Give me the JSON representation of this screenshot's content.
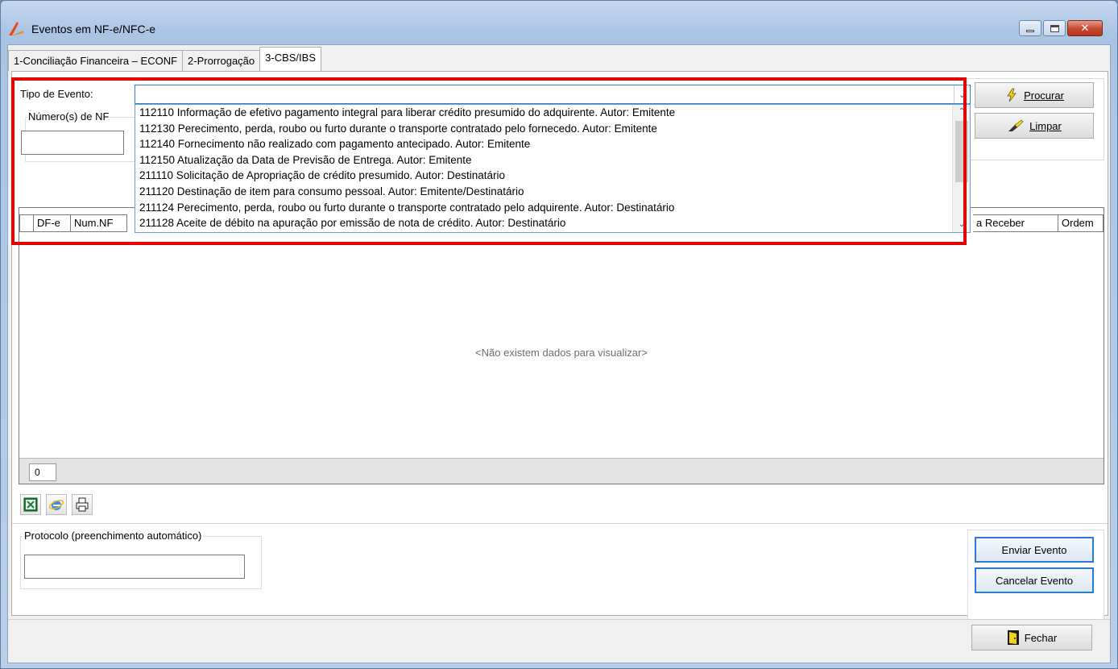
{
  "window": {
    "title": "Eventos em NF-e/NFC-e"
  },
  "tabs": [
    {
      "label": "1-Conciliação Financeira – ECONF"
    },
    {
      "label": "2-Prorrogação"
    },
    {
      "label": "3-CBS/IBS"
    }
  ],
  "filter": {
    "tipo_evento_label": "Tipo de Evento:",
    "numeros_label": "Número(s) de NF",
    "tipo_evento_value": ""
  },
  "dropdown": {
    "items": [
      "112110 Informação de efetivo pagamento integral para liberar crédito presumido do adquirente. Autor: Emitente",
      "112130 Perecimento, perda, roubo ou furto durante o transporte contratado pelo fornecedo. Autor: Emitente",
      "112140 Fornecimento não realizado com pagamento antecipado. Autor: Emitente",
      "112150 Atualização da Data de Previsão de Entrega. Autor: Emitente",
      "211110 Solicitação de Apropriação de crédito presumido. Autor: Destinatário",
      "211120 Destinação de item para consumo pessoal. Autor: Emitente/Destinatário",
      "211124 Perecimento, perda, roubo ou furto durante o transporte contratado pelo adquirente. Autor: Destinatário",
      "211128 Aceite de débito na apuração por emissão de nota de crédito. Autor: Destinatário"
    ]
  },
  "buttons": {
    "procurar": "Procurar",
    "limpar": "Limpar",
    "enviar": "Enviar Evento",
    "cancelar": "Cancelar Evento",
    "fechar": "Fechar"
  },
  "grid": {
    "columns_left": [
      "DF-e",
      "Num.NF"
    ],
    "columns_right": [
      "a Receber",
      "Ordem"
    ],
    "empty_message": "<Não existem dados para visualizar>",
    "count": "0"
  },
  "protocolo": {
    "label": "Protocolo (preenchimento automático)",
    "value": ""
  },
  "colors": {
    "highlight": "#e30000",
    "accent": "#2a7ad2"
  }
}
